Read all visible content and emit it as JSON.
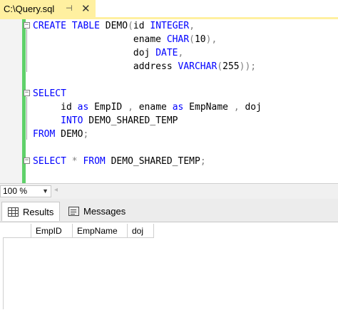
{
  "document_tab": {
    "title": "C:\\Query.sql",
    "pin_glyph": "⊣",
    "close_glyph": "✕"
  },
  "editor": {
    "lines": [
      {
        "text": "CREATE TABLE DEMO(id INTEGER,"
      },
      {
        "text": "                  ename CHAR(10),"
      },
      {
        "text": "                  doj DATE,"
      },
      {
        "text": "                  address VARCHAR(255));"
      },
      {
        "text": ""
      },
      {
        "text": "SELECT"
      },
      {
        "text": "     id as EmpID , ename as EmpName , doj"
      },
      {
        "text": "     INTO DEMO_SHARED_TEMP"
      },
      {
        "text": "FROM DEMO;"
      },
      {
        "text": ""
      },
      {
        "text": "SELECT * FROM DEMO_SHARED_TEMP;"
      }
    ]
  },
  "zoom": {
    "value": "100 %"
  },
  "results": {
    "tabs": [
      {
        "label": "Results",
        "icon": "grid-icon"
      },
      {
        "label": "Messages",
        "icon": "messages-icon"
      }
    ],
    "columns": [
      "EmpID",
      "EmpName",
      "doj"
    ]
  },
  "colors": {
    "tab_active": "#fff0a0",
    "change_bar": "#5fd16a",
    "keyword": "#0000ff",
    "operator": "#808080",
    "function": "#ff00ff"
  }
}
